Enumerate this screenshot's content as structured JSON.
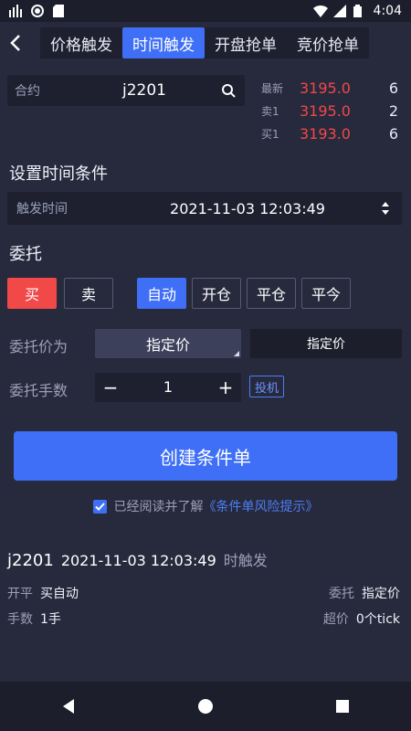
{
  "status_bar": {
    "time": "4:04",
    "icons": [
      "signal-bars-icon",
      "circle-icon",
      "sd-card-icon",
      "wifi-icon",
      "cell-signal-icon",
      "battery-icon"
    ]
  },
  "nav": {
    "tabs": [
      {
        "label": "价格触发",
        "active": false
      },
      {
        "label": "时间触发",
        "active": true
      },
      {
        "label": "开盘抢单",
        "active": false
      },
      {
        "label": "竞价抢单",
        "active": false
      }
    ]
  },
  "contract": {
    "label": "合约",
    "value": "j2201"
  },
  "quotes": [
    {
      "label": "最新",
      "price": "3195.0",
      "qty": "6"
    },
    {
      "label": "卖1",
      "price": "3195.0",
      "qty": "2"
    },
    {
      "label": "买1",
      "price": "3193.0",
      "qty": "6"
    }
  ],
  "time_condition": {
    "title": "设置时间条件",
    "label": "触发时间",
    "value": "2021-11-03 12:03:49"
  },
  "order": {
    "title": "委托",
    "buy_label": "买",
    "sell_label": "卖",
    "modes": [
      "自动",
      "开仓",
      "平仓",
      "平今"
    ],
    "price_label": "委托价为",
    "price_type_a": "指定价",
    "price_type_b": "指定价",
    "qty_label": "委托手数",
    "qty_value": "1",
    "minus": "−",
    "plus": "+",
    "hedge": "投机"
  },
  "create_button": "创建条件单",
  "agreement": {
    "text": "已经阅读并了解",
    "link": "《条件单风险提示》",
    "checked": true
  },
  "summary": {
    "contract": "j2201",
    "time": "2021-11-03 12:03:49",
    "suffix": "时触发",
    "open_close_label": "开平",
    "open_close_value": "买自动",
    "lots_label": "手数",
    "lots_value": "1手",
    "entrust_label": "委托",
    "entrust_value": "指定价",
    "over_label": "超价",
    "over_value": "0个tick"
  },
  "colors": {
    "accent": "#3f6ff6",
    "buy": "#f14848",
    "background": "#272a3d"
  }
}
